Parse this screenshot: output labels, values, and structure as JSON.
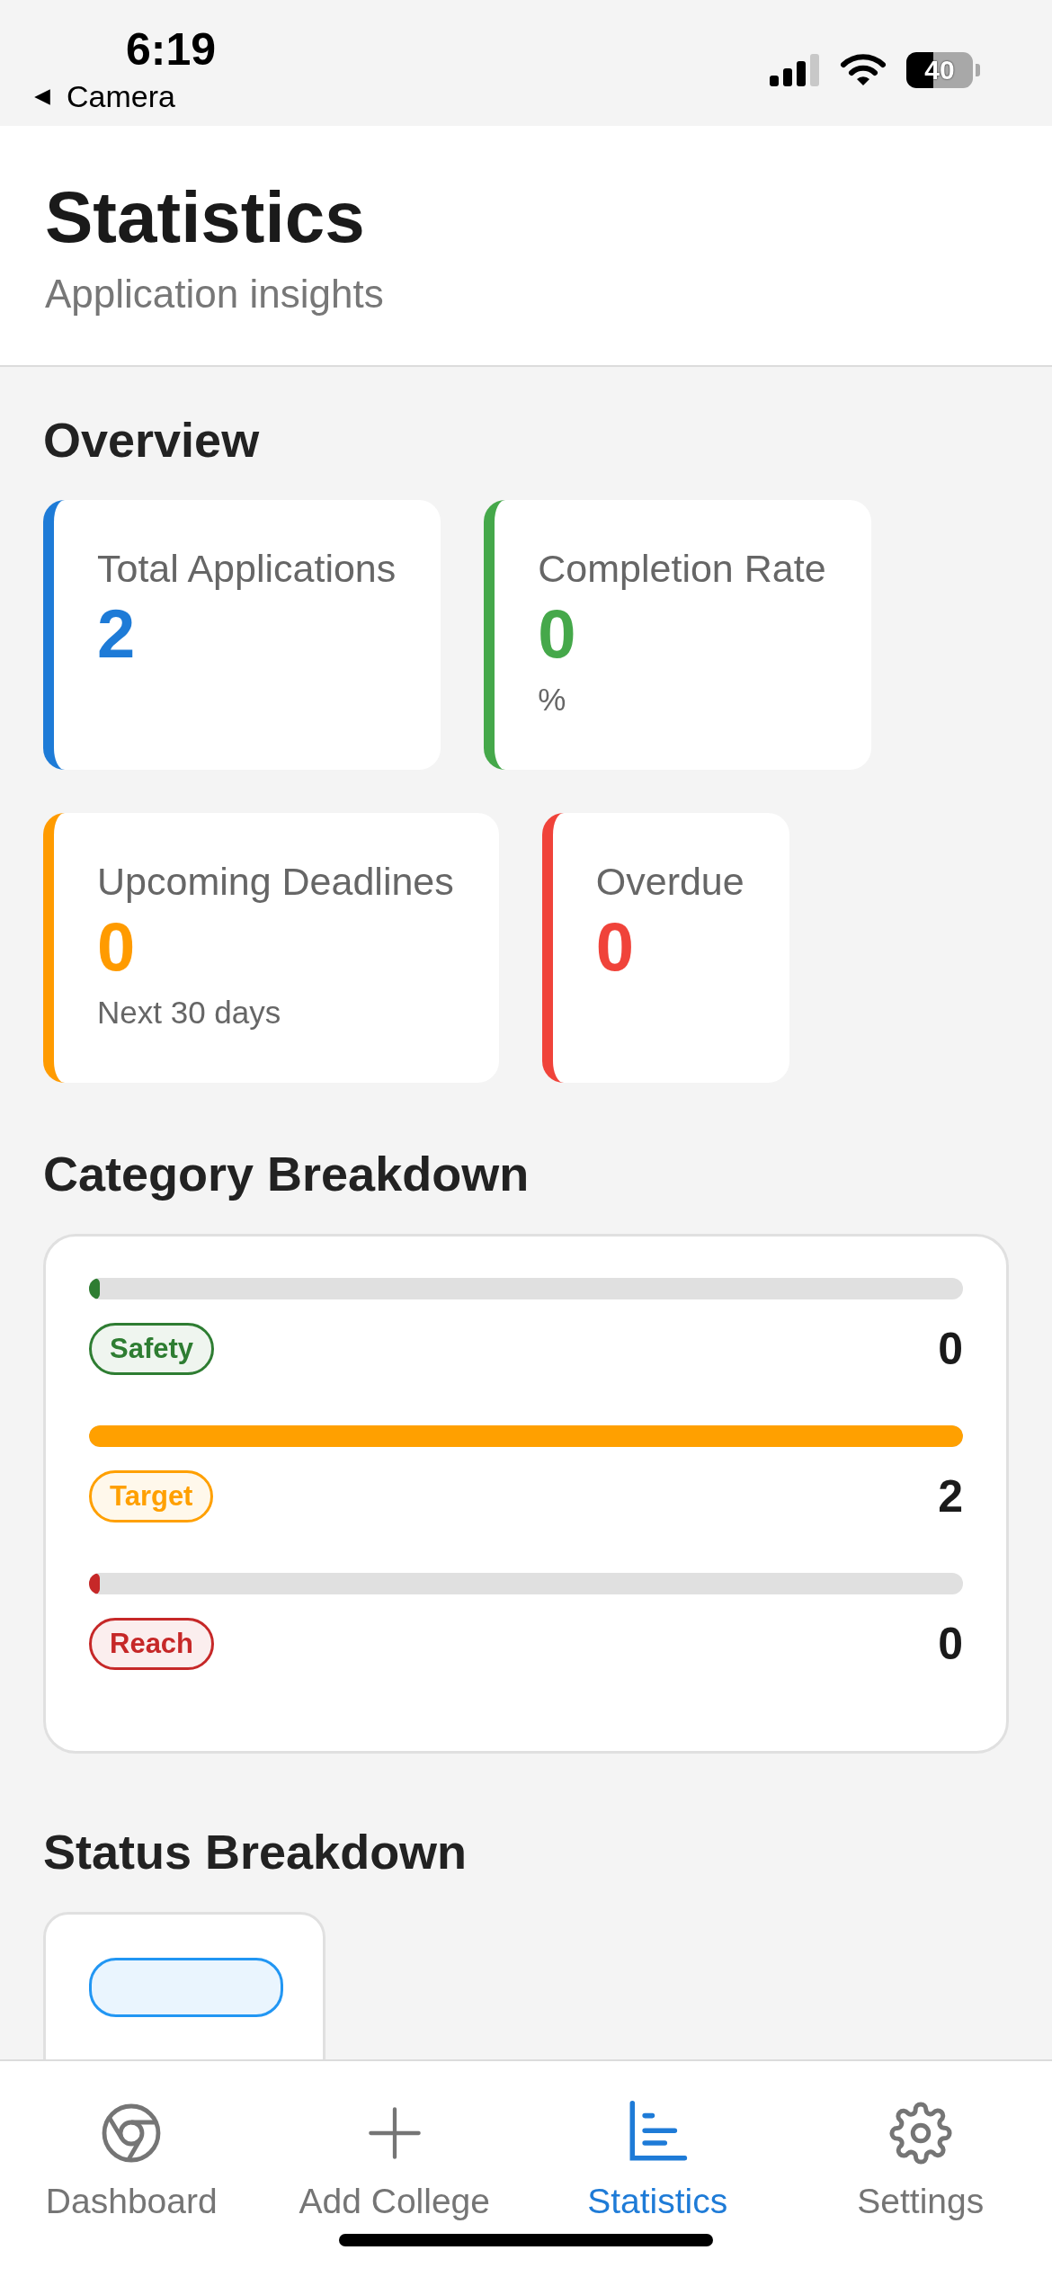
{
  "status_bar": {
    "time": "6:19",
    "back_label": "Camera",
    "battery": "40"
  },
  "header": {
    "title": "Statistics",
    "subtitle": "Application insights"
  },
  "overview": {
    "title": "Overview",
    "cards": [
      {
        "label": "Total Applications",
        "value": "2",
        "color": "#1e7bd7"
      },
      {
        "label": "Completion Rate",
        "value": "0",
        "note": "%",
        "color": "#45a84a"
      },
      {
        "label": "Upcoming Deadlines",
        "value": "0",
        "note": "Next 30 days",
        "color": "#ff9b00"
      },
      {
        "label": "Overdue",
        "value": "0",
        "color": "#f0433a"
      }
    ]
  },
  "category_breakdown": {
    "title": "Category Breakdown",
    "items": [
      {
        "label": "Safety",
        "count": "0",
        "level": 0,
        "color": "#2e7d32"
      },
      {
        "label": "Target",
        "count": "2",
        "level": 1,
        "color": "#ffa000"
      },
      {
        "label": "Reach",
        "count": "0",
        "level": 0,
        "color": "#c62828"
      }
    ]
  },
  "status_breakdown": {
    "title": "Status Breakdown",
    "badges": [
      {
        "color": "#2196f3"
      }
    ]
  },
  "tab_bar": [
    {
      "label": "Dashboard",
      "selected": false
    },
    {
      "label": "Add College",
      "selected": false
    },
    {
      "label": "Statistics",
      "selected": true
    },
    {
      "label": "Settings",
      "selected": false
    }
  ]
}
